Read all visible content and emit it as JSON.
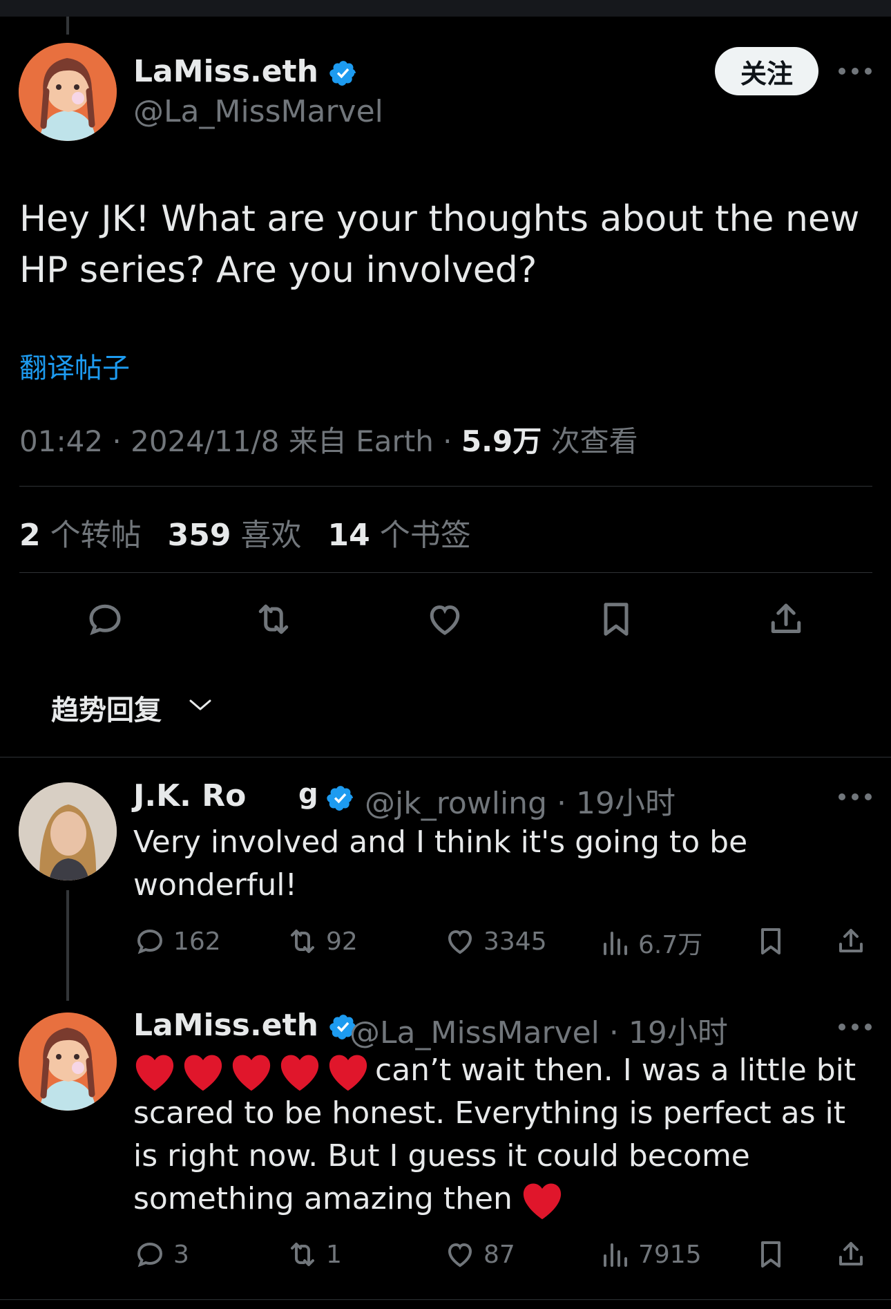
{
  "tweet": {
    "author_name": "LaMiss.eth",
    "author_handle": "@La_MissMarvel",
    "follow_label": "关注",
    "text": "Hey JK! What are your thoughts about the new HP series? Are you involved?",
    "translate_label": "翻译帖子",
    "time": "01:42",
    "date": "2024/11/8",
    "source": "来自 Earth",
    "views_count": "5.9万",
    "views_label": "次查看",
    "reposts_count": "2",
    "reposts_label": "个转帖",
    "likes_count": "359",
    "likes_label": "喜欢",
    "bookmarks_count": "14",
    "bookmarks_label": "个书签"
  },
  "sort_label": "趋势回复",
  "replies": [
    {
      "author_name": "J.K. Ro",
      "author_name_fragment": "g",
      "author_handle": "@jk_rowling",
      "time": "19小时",
      "text": "Very involved and I think it's going to be wonderful!",
      "replies": "162",
      "reposts": "92",
      "likes": "3345",
      "views": "6.7万"
    },
    {
      "author_name": "LaMiss.eth",
      "author_handle": "@La_MissMarvel",
      "time": "19小时",
      "text_after_hearts": "can’t wait then. I was a little bit scared to be honest. Everything is perfect as it is right now. But I guess it could become something amazing then",
      "heart_count": 5,
      "replies": "3",
      "reposts": "1",
      "likes": "87",
      "views": "7915"
    }
  ],
  "colors": {
    "background": "#000000",
    "text": "#e7e9ea",
    "secondary": "#71767b",
    "accent": "#1d9bf0",
    "divider": "#2f3336",
    "heart_emoji": "#e0162b"
  }
}
